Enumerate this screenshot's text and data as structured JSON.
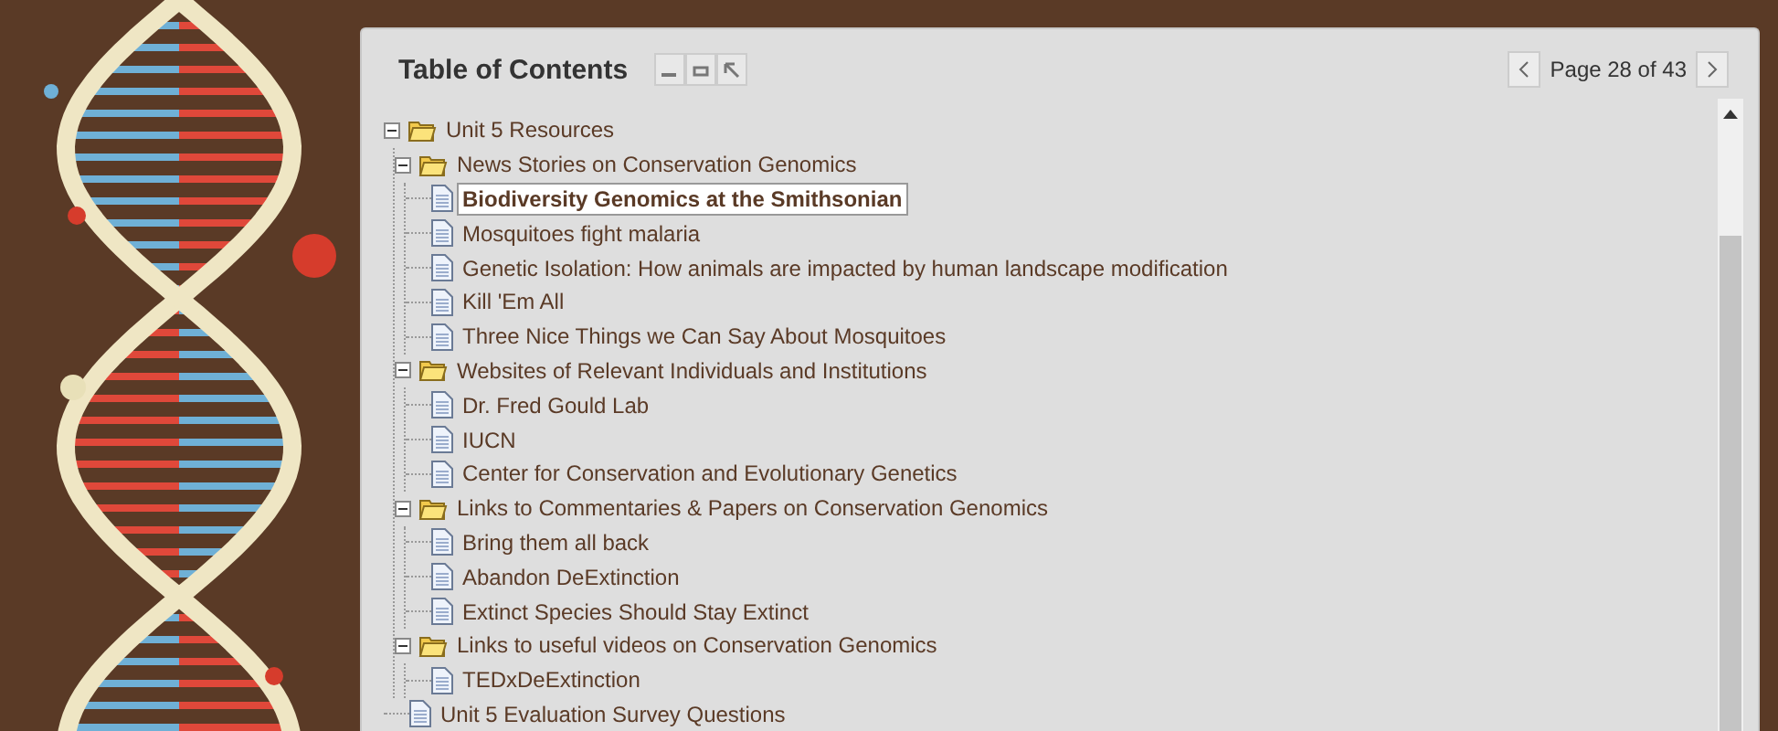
{
  "panel": {
    "title": "Table of Contents",
    "pager": {
      "label": "Page 28 of 43"
    }
  },
  "tree": [
    {
      "kind": "folder",
      "label": "Unit 5 Resources",
      "expanded": true,
      "children": [
        {
          "kind": "folder",
          "label": "News Stories on Conservation Genomics",
          "expanded": true,
          "children": [
            {
              "kind": "page",
              "label": "Biodiversity Genomics at the Smithsonian",
              "selected": true
            },
            {
              "kind": "page",
              "label": "Mosquitoes fight malaria",
              "selected": false
            },
            {
              "kind": "page",
              "label": "Genetic Isolation: How animals are impacted by human landscape modification",
              "selected": false
            },
            {
              "kind": "page",
              "label": "Kill 'Em All",
              "selected": false
            },
            {
              "kind": "page",
              "label": "Three Nice Things we Can Say About Mosquitoes",
              "selected": false
            }
          ]
        },
        {
          "kind": "folder",
          "label": "Websites of Relevant Individuals and Institutions",
          "expanded": true,
          "children": [
            {
              "kind": "page",
              "label": "Dr. Fred Gould Lab",
              "selected": false
            },
            {
              "kind": "page",
              "label": "IUCN",
              "selected": false
            },
            {
              "kind": "page",
              "label": "Center for Conservation and Evolutionary Genetics",
              "selected": false
            }
          ]
        },
        {
          "kind": "folder",
          "label": "Links to Commentaries & Papers on Conservation Genomics",
          "expanded": true,
          "children": [
            {
              "kind": "page",
              "label": "Bring them all back",
              "selected": false
            },
            {
              "kind": "page",
              "label": "Abandon DeExtinction",
              "selected": false
            },
            {
              "kind": "page",
              "label": "Extinct Species Should Stay Extinct",
              "selected": false
            }
          ]
        },
        {
          "kind": "folder",
          "label": "Links to useful videos on Conservation Genomics",
          "expanded": true,
          "children": [
            {
              "kind": "page",
              "label": "TEDxDeExtinction",
              "selected": false
            }
          ]
        }
      ]
    },
    {
      "kind": "page",
      "label": "Unit 5 Evaluation Survey Questions",
      "selected": false
    }
  ]
}
